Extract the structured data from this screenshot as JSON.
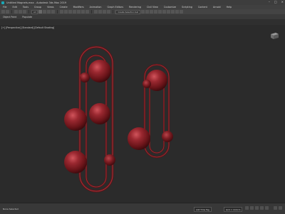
{
  "window": {
    "title": "Untitled Magnets.max - Autodesk 3ds Max 2019"
  },
  "menu": [
    "File",
    "Edit",
    "Tools",
    "Group",
    "Views",
    "Create",
    "Modifiers",
    "Animation",
    "Graph Editors",
    "Rendering",
    "Civil View",
    "Customize",
    "Scripting",
    "Content",
    "Arnold",
    "Help"
  ],
  "toolbar": {
    "selection_filter": "All",
    "named_selection": "Create Selection Set"
  },
  "ribbon": {
    "tabs": [
      "Object Paint",
      "Populate"
    ]
  },
  "viewport": {
    "label": "[+] [Perspective] [Standard] [Default Shading]"
  },
  "status": {
    "left_text": "None Selected",
    "grid": "Grid = 10.0cm",
    "add_time_tag": "Add Time Tag"
  },
  "colors": {
    "object": "#7a1a1f",
    "highlight": "#c0454c",
    "viewport_bg": "#2b2b2b"
  }
}
